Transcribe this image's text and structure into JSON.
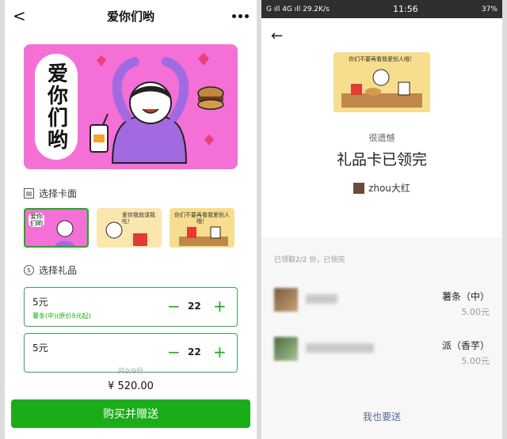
{
  "left": {
    "header": {
      "back": "<",
      "title": "爱你们哟"
    },
    "hero": {
      "text": "爱你们哟"
    },
    "card_section": {
      "label": "选择卡面"
    },
    "thumbs": [
      {
        "caption": "爱你们哟"
      },
      {
        "caption": "爱你我就请我吃！"
      },
      {
        "caption": "你们不要再看我爱别人哦！"
      }
    ],
    "gift_section": {
      "label": "选择礼品"
    },
    "gifts": [
      {
        "name": "5元",
        "sub": "薯条(中)(原价9元起)",
        "minus": "−",
        "qty": "22",
        "plus": "+"
      },
      {
        "name": "5元",
        "sub": "",
        "minus": "−",
        "qty": "22",
        "plus": "+"
      }
    ],
    "total": {
      "count": "共9/9份",
      "amount": "¥ 520.00"
    },
    "buy_label": "购买并赠送"
  },
  "right": {
    "status": {
      "left": "G ıll 4G ıll 29.2K/s",
      "time": "11:56",
      "right": "37%"
    },
    "back": "←",
    "card_caption": "你们不要再看我爱别人哦！",
    "sorry": "很遗憾",
    "done": "礼品卡已领完",
    "sender": "zhou大红",
    "claimed": "已领取2/2 份，已领完",
    "rows": [
      {
        "item": "薯条（中）",
        "price": "5.00元"
      },
      {
        "item": "派（香芋）",
        "price": "5.00元"
      }
    ],
    "me_too": "我也要送"
  },
  "colors": {
    "primary": "#1aad19",
    "hero_bg": "#f46fd6",
    "link": "#576b95"
  }
}
